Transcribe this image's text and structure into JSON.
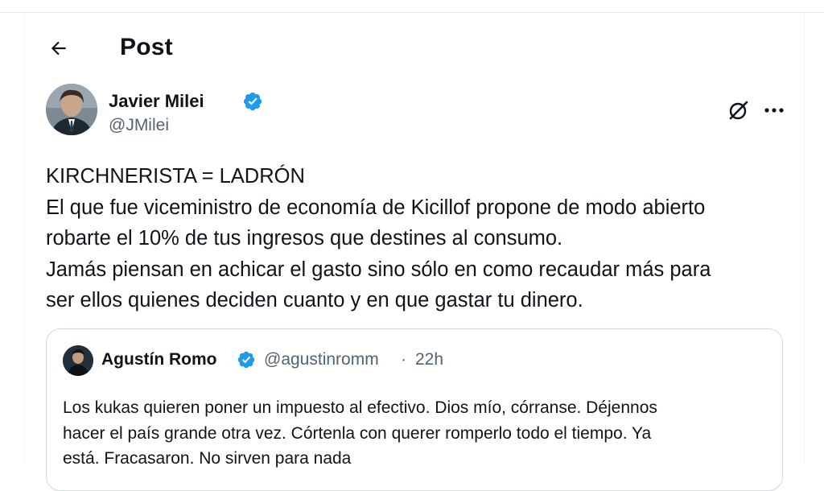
{
  "header": {
    "title": "Post",
    "back_icon": "arrow-left-icon"
  },
  "post": {
    "author_name": "Javier Milei",
    "author_handle": "@JMilei",
    "verified_icon": "verified-badge-icon",
    "verified_color": "#1d9bf0",
    "grok_icon": "grok-icon",
    "more_icon": "more-horizontal-icon",
    "text_lines": [
      "KIRCHNERISTA = LADRÓN",
      "El que fue viceministro de economía de Kicillof propone de modo abierto",
      "robarte el 10% de tus ingresos que destines al consumo.",
      "Jamás piensan en achicar el gasto sino sólo en como recaudar más para",
      "ser ellos quienes deciden cuanto y en que gastar tu dinero."
    ]
  },
  "quote": {
    "author_name": "Agustín Romo",
    "author_handle": "@agustinromm",
    "separator": "·",
    "time": "22h",
    "text_lines": [
      "Los kukas quieren poner un impuesto al efectivo. Dios mío, córranse. Déjennos",
      "hacer el país grande otra vez. Córtenla con querer romperlo todo el tiempo. Ya",
      "está. Fracasaron. No sirven para nada"
    ]
  }
}
